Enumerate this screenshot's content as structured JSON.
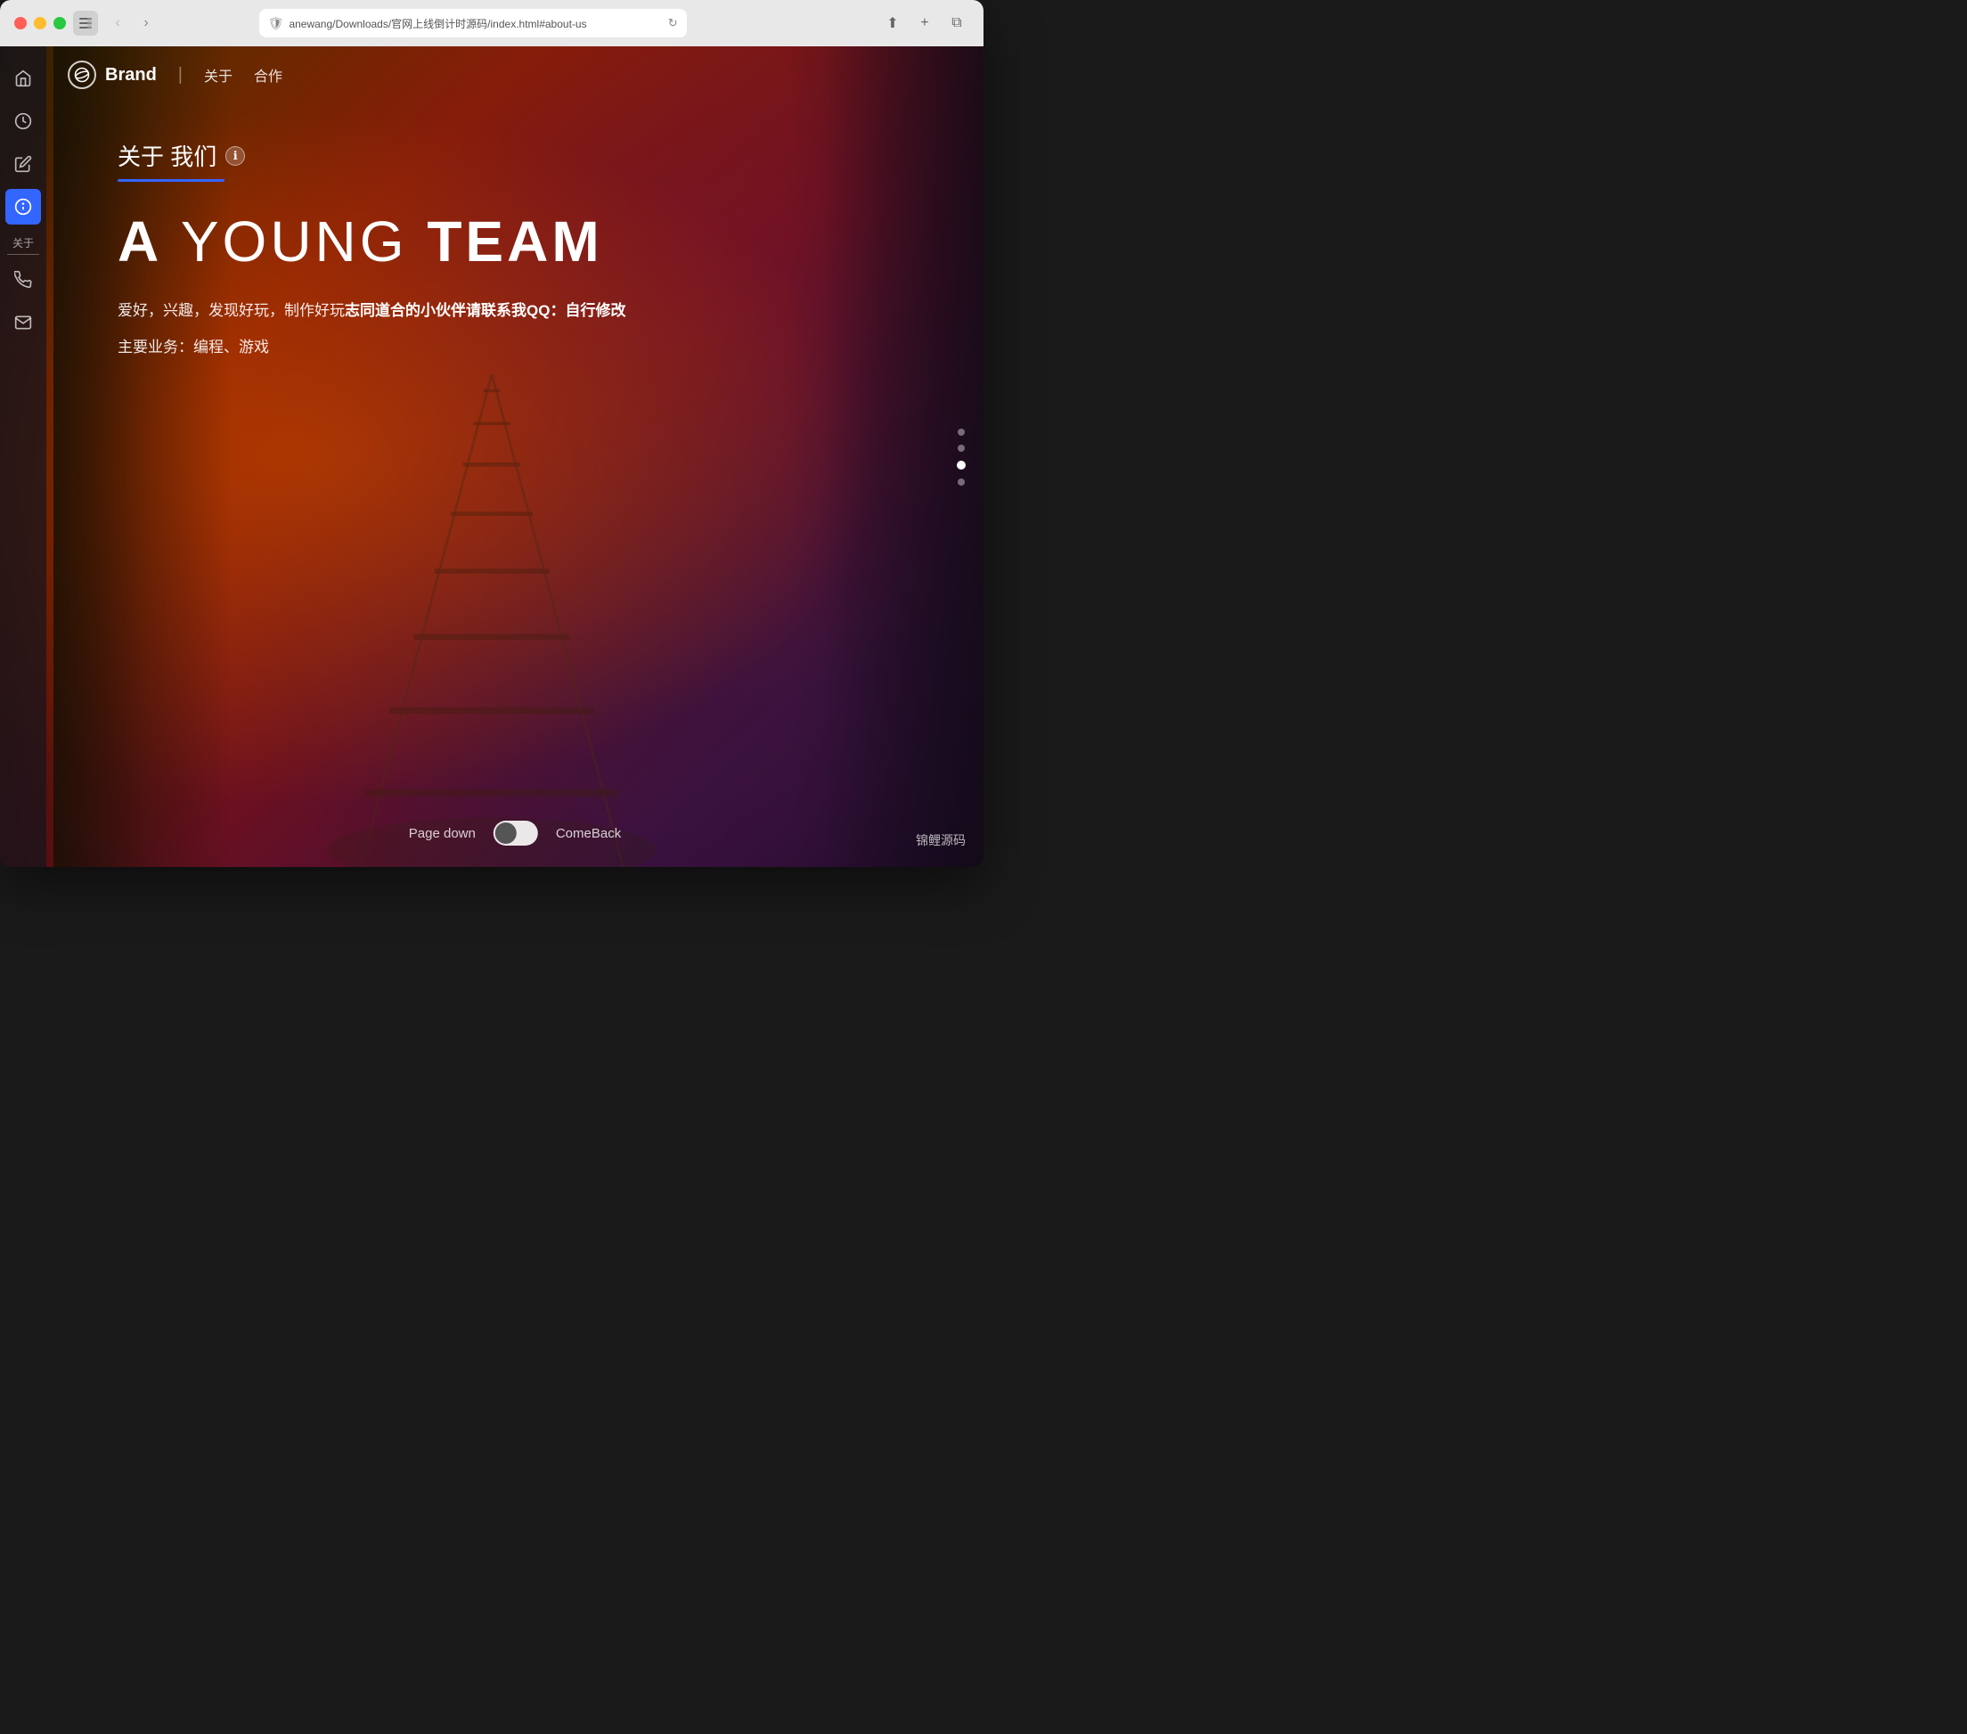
{
  "window": {
    "title": "官网上线倒计时源码",
    "address": "anewang/Downloads/官网上线倒计时源码/index.html#about-us"
  },
  "nav": {
    "brand": "Brand",
    "brand_icon": "🪐",
    "links": [
      "关于",
      "合作"
    ],
    "divider": "|"
  },
  "sidebar": {
    "icons": [
      {
        "name": "home",
        "symbol": "⌂",
        "active": false
      },
      {
        "name": "clock",
        "symbol": "◷",
        "active": false
      },
      {
        "name": "edit",
        "symbol": "✎",
        "active": false
      },
      {
        "name": "info",
        "symbol": "ℹ",
        "active": true
      },
      {
        "name": "phone",
        "symbol": "✆",
        "active": false
      },
      {
        "name": "mail",
        "symbol": "✉",
        "active": false
      }
    ],
    "section_label": "关于",
    "section_underline": true
  },
  "hero": {
    "section_title": "关于 我们",
    "main_title_a": "A",
    "main_title_middle": " YOUNG ",
    "main_title_team": "TEAM",
    "desc1_prefix": "爱好，兴趣，发现好玩，制作好玩",
    "desc1_highlight": "志同道合的小伙伴请联系我QQ：自行修改",
    "desc2": "主要业务：编程、游戏"
  },
  "dots": {
    "count": 4,
    "active_index": 2
  },
  "bottom": {
    "page_down": "Page down",
    "come_back": "ComeBack"
  },
  "watermark": "锦鲤源码",
  "colors": {
    "accent_blue": "#3366ff",
    "bg_dark": "#1a0828",
    "sidebar_active": "#3366ff"
  }
}
